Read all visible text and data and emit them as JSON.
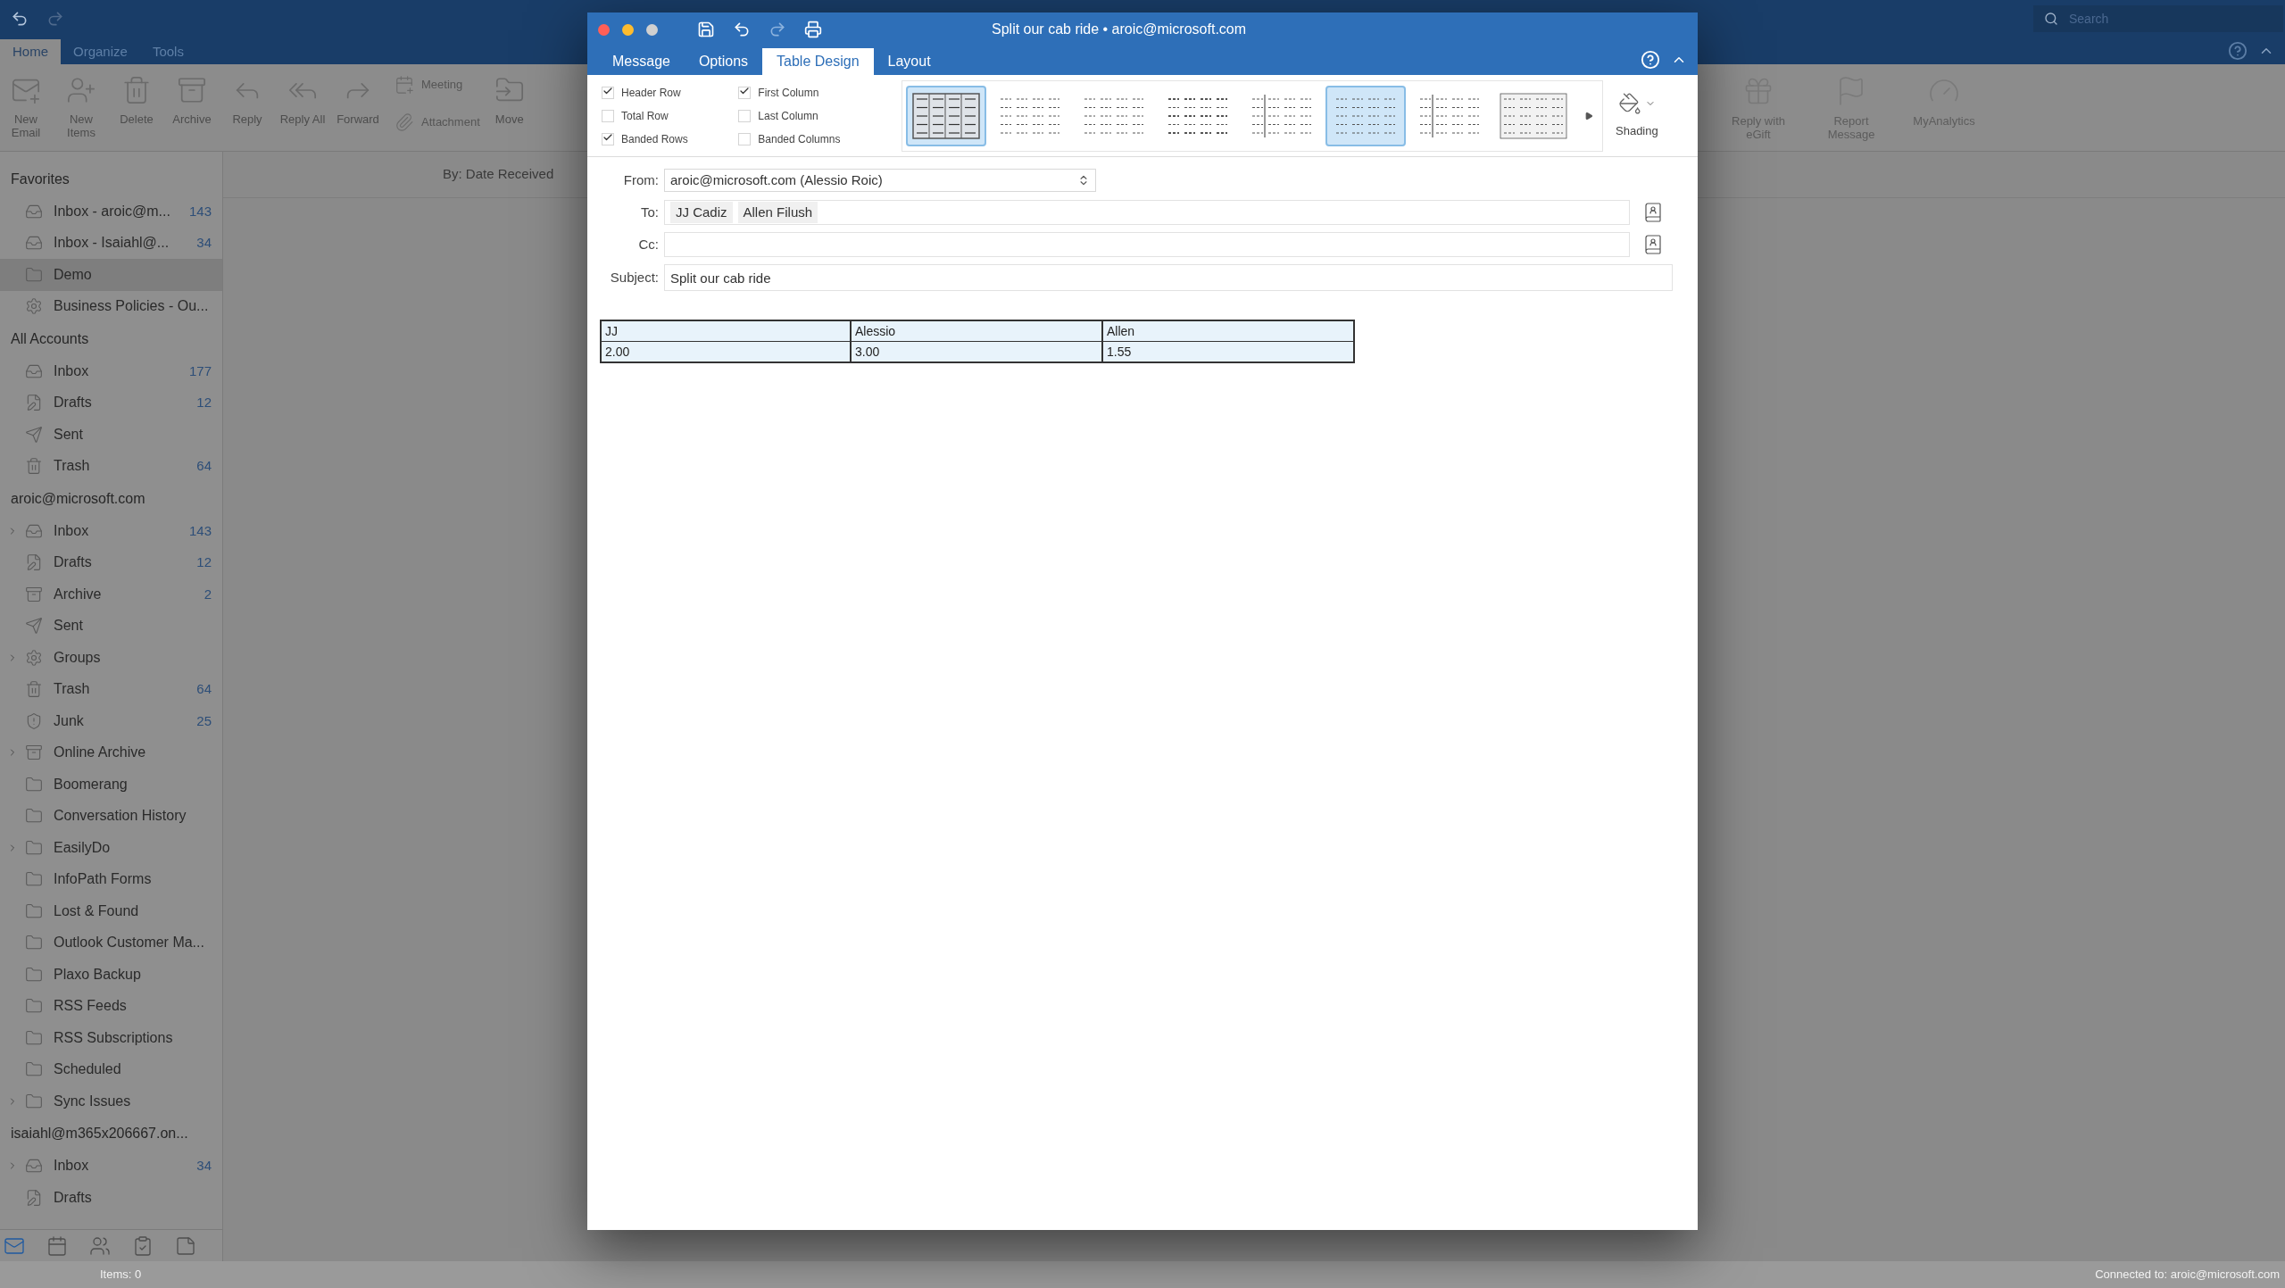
{
  "main_window": {
    "search": {
      "placeholder": "Search"
    },
    "tabs": [
      {
        "label": "Home",
        "selected": true
      },
      {
        "label": "Organize",
        "selected": false
      },
      {
        "label": "Tools",
        "selected": false
      }
    ],
    "ribbon_left": [
      {
        "kind": "new-email",
        "label": "New Email"
      },
      {
        "kind": "new-items",
        "label": "New Items"
      },
      {
        "kind": "delete",
        "label": "Delete"
      },
      {
        "kind": "archive",
        "label": "Archive"
      },
      {
        "kind": "reply",
        "label": "Reply"
      },
      {
        "kind": "reply-all",
        "label": "Reply All"
      },
      {
        "kind": "forward",
        "label": "Forward"
      }
    ],
    "ribbon_small": [
      {
        "kind": "meeting",
        "label": "Meeting"
      },
      {
        "kind": "attachment",
        "label": "Attachment"
      }
    ],
    "ribbon_move": {
      "kind": "move",
      "label": "Move"
    },
    "ribbon_right": [
      {
        "kind": "gift",
        "label": "Reply with eGift"
      },
      {
        "kind": "report",
        "label": "Report Message"
      },
      {
        "kind": "analytics",
        "label": "MyAnalytics"
      }
    ],
    "sort_label": "By: Date Received",
    "sidebar": [
      {
        "heading": "Favorites",
        "items": [
          {
            "kind": "inbox",
            "label": "Inbox - aroic@m...",
            "count": "143",
            "expandable": false,
            "selected": false
          },
          {
            "kind": "inbox",
            "label": "Inbox - Isaiahl@...",
            "count": "34",
            "expandable": false,
            "selected": false
          },
          {
            "kind": "folder",
            "label": "Demo",
            "expandable": false,
            "selected": true
          },
          {
            "kind": "gear",
            "label": "Business Policies - Ou...",
            "expandable": false,
            "selected": false
          }
        ]
      },
      {
        "heading": "All Accounts",
        "items": [
          {
            "kind": "inbox",
            "label": "Inbox",
            "count": "177",
            "expandable": false,
            "selected": false
          },
          {
            "kind": "drafts",
            "label": "Drafts",
            "count": "12",
            "expandable": false,
            "selected": false
          },
          {
            "kind": "sent",
            "label": "Sent",
            "expandable": false,
            "selected": false
          },
          {
            "kind": "trash",
            "label": "Trash",
            "count": "64",
            "expandable": false,
            "selected": false
          }
        ]
      },
      {
        "heading": "aroic@microsoft.com",
        "items": [
          {
            "kind": "inbox",
            "label": "Inbox",
            "count": "143",
            "expandable": true,
            "selected": false
          },
          {
            "kind": "drafts",
            "label": "Drafts",
            "count": "12",
            "expandable": false,
            "selected": false
          },
          {
            "kind": "archive",
            "label": "Archive",
            "count": "2",
            "expandable": false,
            "selected": false
          },
          {
            "kind": "sent",
            "label": "Sent",
            "expandable": false,
            "selected": false
          },
          {
            "kind": "gear",
            "label": "Groups",
            "expandable": true,
            "selected": false
          },
          {
            "kind": "trash",
            "label": "Trash",
            "count": "64",
            "expandable": false,
            "selected": false
          },
          {
            "kind": "junk",
            "label": "Junk",
            "count": "25",
            "expandable": false,
            "selected": false
          },
          {
            "kind": "archive",
            "label": "Online Archive",
            "expandable": true,
            "selected": false
          },
          {
            "kind": "folder",
            "label": "Boomerang",
            "expandable": false,
            "selected": false
          },
          {
            "kind": "folder",
            "label": "Conversation History",
            "expandable": false,
            "selected": false
          },
          {
            "kind": "folder",
            "label": "EasilyDo",
            "expandable": true,
            "selected": false
          },
          {
            "kind": "folder",
            "label": "InfoPath Forms",
            "expandable": false,
            "selected": false
          },
          {
            "kind": "folder",
            "label": "Lost & Found",
            "expandable": false,
            "selected": false
          },
          {
            "kind": "folder",
            "label": "Outlook Customer Ma...",
            "expandable": false,
            "selected": false
          },
          {
            "kind": "folder",
            "label": "Plaxo Backup",
            "expandable": false,
            "selected": false
          },
          {
            "kind": "folder",
            "label": "RSS Feeds",
            "expandable": false,
            "selected": false
          },
          {
            "kind": "folder",
            "label": "RSS Subscriptions",
            "expandable": false,
            "selected": false
          },
          {
            "kind": "folder",
            "label": "Scheduled",
            "expandable": false,
            "selected": false
          },
          {
            "kind": "folder",
            "label": "Sync Issues",
            "expandable": true,
            "selected": false
          }
        ]
      },
      {
        "heading": "isaiahl@m365x206667.on...",
        "items": [
          {
            "kind": "inbox",
            "label": "Inbox",
            "count": "34",
            "expandable": true,
            "selected": false
          },
          {
            "kind": "drafts",
            "label": "Drafts",
            "expandable": false,
            "selected": false
          }
        ]
      }
    ],
    "nav": [
      {
        "kind": "mail",
        "selected": true
      },
      {
        "kind": "calendar",
        "selected": false
      },
      {
        "kind": "people",
        "selected": false
      },
      {
        "kind": "tasks",
        "selected": false
      },
      {
        "kind": "notes",
        "selected": false
      }
    ],
    "status_left": "Items: 0",
    "status_right": "Connected to: aroic@microsoft.com"
  },
  "compose": {
    "title": "Split our cab ride • aroic@microsoft.com",
    "tabs": [
      {
        "label": "Message",
        "selected": false
      },
      {
        "label": "Options",
        "selected": false
      },
      {
        "label": "Table Design",
        "selected": true
      },
      {
        "label": "Layout",
        "selected": false
      }
    ],
    "options": [
      {
        "label": "Header Row",
        "checked": true
      },
      {
        "label": "Total Row",
        "checked": false
      },
      {
        "label": "Banded Rows",
        "checked": true
      },
      {
        "label": "First Column",
        "checked": true
      },
      {
        "label": "Last Column",
        "checked": false
      },
      {
        "label": "Banded Columns",
        "checked": false
      }
    ],
    "styles": [
      {
        "kind": "grid",
        "selected": true
      },
      {
        "kind": "plain",
        "selected": false
      },
      {
        "kind": "plain",
        "selected": false
      },
      {
        "kind": "banded",
        "selected": false
      },
      {
        "kind": "first-column",
        "selected": false
      },
      {
        "kind": "plain",
        "selected": true
      },
      {
        "kind": "first-column",
        "selected": false
      },
      {
        "kind": "grid-light",
        "selected": false
      }
    ],
    "shading_label": "Shading",
    "from": {
      "label": "From:",
      "value": "aroic@microsoft.com (Alessio Roic)"
    },
    "to": {
      "label": "To:",
      "recipients": [
        "JJ Cadiz",
        "Allen Filush"
      ]
    },
    "cc": {
      "label": "Cc:"
    },
    "subject": {
      "label": "Subject:",
      "value": "Split our cab ride"
    },
    "table": {
      "header": [
        "JJ",
        "Alessio",
        "Allen"
      ],
      "rows": [
        [
          "2.00",
          "3.00",
          "1.55"
        ]
      ]
    }
  }
}
